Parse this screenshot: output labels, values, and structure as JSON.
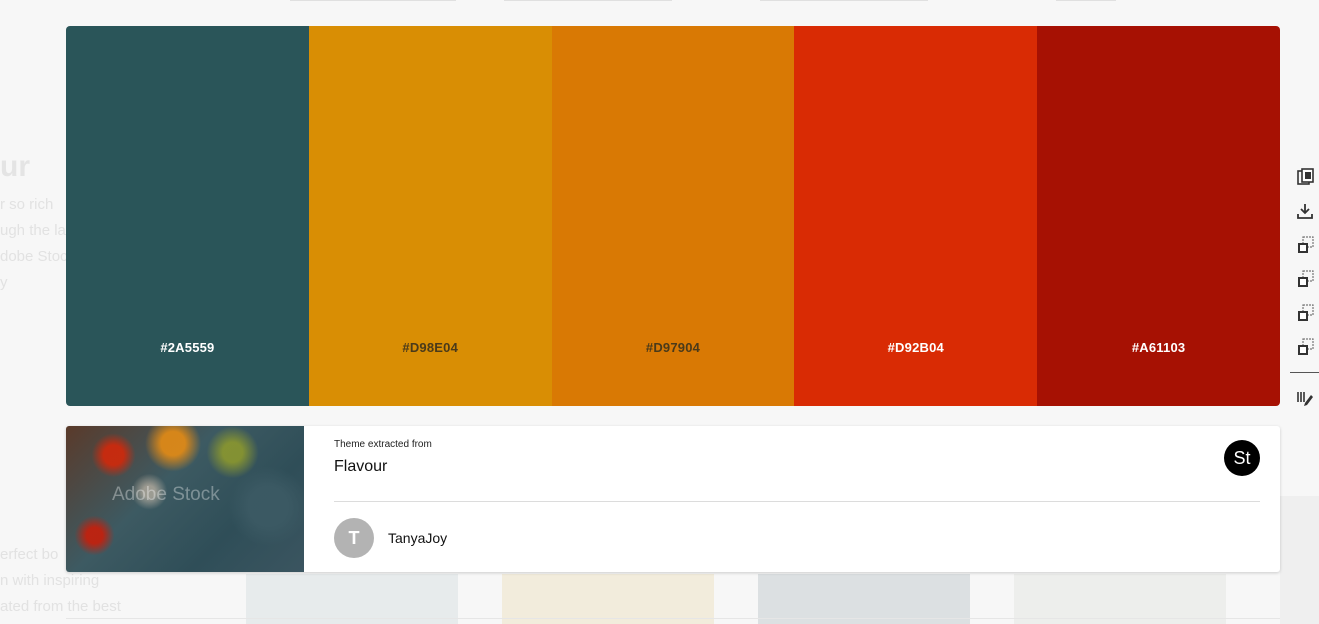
{
  "palette": {
    "swatches": [
      {
        "hex": "#2A5559",
        "label": "#2A5559",
        "label_color": "#ffffff"
      },
      {
        "hex": "#D98E04",
        "label": "#D98E04",
        "label_color": "#4a3a1a"
      },
      {
        "hex": "#D97904",
        "label": "#D97904",
        "label_color": "#4a3a1a"
      },
      {
        "hex": "#D92B04",
        "label": "#D92B04",
        "label_color": "#ffffff"
      },
      {
        "hex": "#A61103",
        "label": "#A61103",
        "label_color": "#ffffff"
      }
    ]
  },
  "toolbar": {
    "icons": [
      "copy-icon",
      "download-icon",
      "copy-to-library-icon",
      "copy-to-library-icon-2",
      "copy-to-library-icon-3",
      "copy-to-library-icon-4",
      "edit-icon"
    ]
  },
  "card": {
    "extract_label": "Theme extracted from",
    "theme_title": "Flavour",
    "stock_badge": "St",
    "watermark": "Adobe Stock",
    "author_initial": "T",
    "author_name": "TanyaJoy"
  },
  "background": {
    "left_title": "ur",
    "left_lines": [
      "r so rich",
      "ugh the la",
      "dobe Stock",
      "y"
    ],
    "left_lines_bottom": [
      "erfect bo",
      "n with inspiring",
      "ated from the best"
    ]
  }
}
